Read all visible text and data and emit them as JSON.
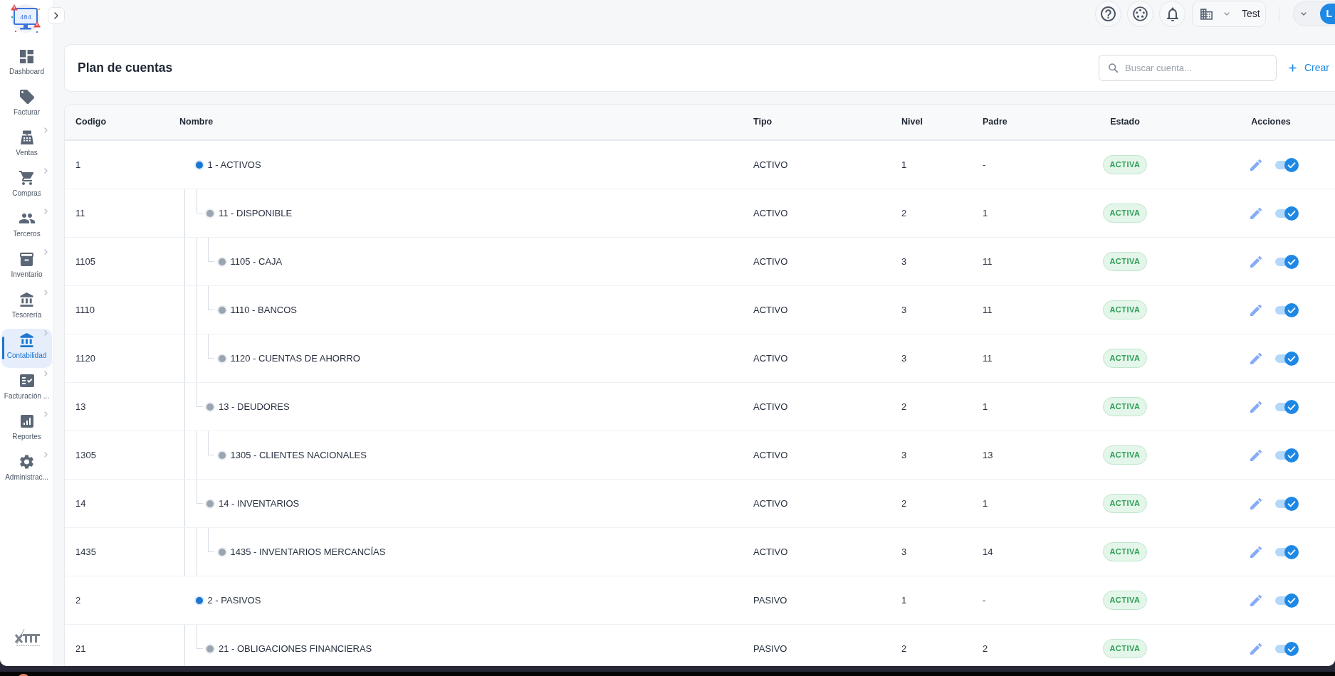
{
  "sidebar": {
    "logo_text": "404",
    "items": [
      {
        "label": "Dashboard",
        "expandable": false,
        "selected": false
      },
      {
        "label": "Facturar",
        "expandable": false,
        "selected": false
      },
      {
        "label": "Ventas",
        "expandable": true,
        "selected": false
      },
      {
        "label": "Compras",
        "expandable": true,
        "selected": false
      },
      {
        "label": "Terceros",
        "expandable": true,
        "selected": false
      },
      {
        "label": "Inventario",
        "expandable": true,
        "selected": false
      },
      {
        "label": "Tesorería",
        "expandable": true,
        "selected": false
      },
      {
        "label": "Contabilidad",
        "expandable": true,
        "selected": true
      },
      {
        "label": "Facturación ...",
        "expandable": true,
        "selected": false
      },
      {
        "label": "Reportes",
        "expandable": true,
        "selected": false
      },
      {
        "label": "Administrac...",
        "expandable": true,
        "selected": false
      }
    ]
  },
  "topbar": {
    "company": "Test",
    "user_initial": "L"
  },
  "page": {
    "title": "Plan de cuentas",
    "search": {
      "placeholder": "Buscar cuenta..."
    },
    "create_label": "Crear"
  },
  "table": {
    "columns": [
      "Codigo",
      "Nombre",
      "Tipo",
      "Nivel",
      "Padre",
      "Estado",
      "Acciones"
    ],
    "rows": [
      {
        "code": "1",
        "name": "1 - ACTIVOS",
        "type": "ACTIVO",
        "account_level": "1",
        "parent": "-",
        "status": "ACTIVA",
        "on": true,
        "children": [
          {
            "code": "11",
            "name": "11 - DISPONIBLE",
            "type": "ACTIVO",
            "account_level": "2",
            "parent": "1",
            "status": "ACTIVA",
            "on": true,
            "children": [
              {
                "code": "1105",
                "name": "1105 - CAJA",
                "type": "ACTIVO",
                "account_level": "3",
                "parent": "11",
                "status": "ACTIVA",
                "on": true
              },
              {
                "code": "1110",
                "name": "1110 - BANCOS",
                "type": "ACTIVO",
                "account_level": "3",
                "parent": "11",
                "status": "ACTIVA",
                "on": true
              },
              {
                "code": "1120",
                "name": "1120 - CUENTAS DE AHORRO",
                "type": "ACTIVO",
                "account_level": "3",
                "parent": "11",
                "status": "ACTIVA",
                "on": true
              }
            ]
          },
          {
            "code": "13",
            "name": "13 - DEUDORES",
            "type": "ACTIVO",
            "account_level": "2",
            "parent": "1",
            "status": "ACTIVA",
            "on": true,
            "children": [
              {
                "code": "1305",
                "name": "1305 - CLIENTES NACIONALES",
                "type": "ACTIVO",
                "account_level": "3",
                "parent": "13",
                "status": "ACTIVA",
                "on": true
              }
            ]
          },
          {
            "code": "14",
            "name": "14 - INVENTARIOS",
            "type": "ACTIVO",
            "account_level": "2",
            "parent": "1",
            "status": "ACTIVA",
            "on": true,
            "children": [
              {
                "code": "1435",
                "name": "1435 - INVENTARIOS MERCANCÍAS",
                "type": "ACTIVO",
                "account_level": "3",
                "parent": "14",
                "status": "ACTIVA",
                "on": true
              }
            ]
          }
        ]
      },
      {
        "code": "2",
        "name": "2 - PASIVOS",
        "type": "PASIVO",
        "account_level": "1",
        "parent": "-",
        "status": "ACTIVA",
        "on": true,
        "children": [
          {
            "code": "21",
            "name": "21 - OBLIGACIONES FINANCIERAS",
            "type": "PASIVO",
            "account_level": "2",
            "parent": "2",
            "status": "ACTIVA",
            "on": true
          }
        ]
      }
    ]
  }
}
